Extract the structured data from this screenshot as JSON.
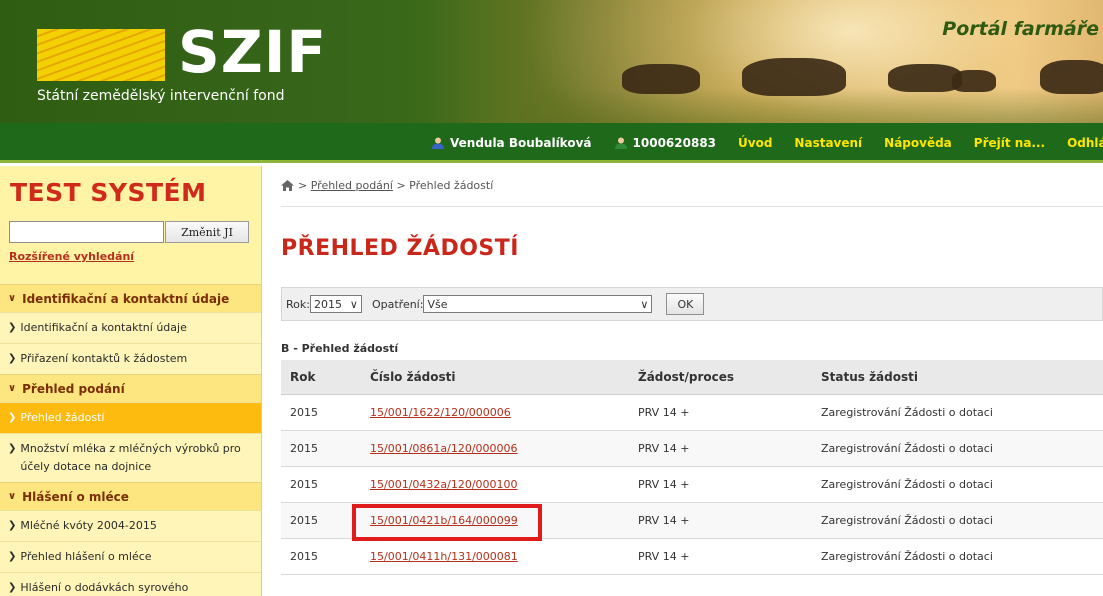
{
  "header": {
    "logo_text": "SZIF",
    "logo_subtitle": "Státní zemědělský intervenční fond",
    "portal_title": "Portál farmáře"
  },
  "nav": {
    "user_name": "Vendula Boubalíková",
    "client_id": "1000620883",
    "items": [
      "Úvod",
      "Nastavení",
      "Nápověda",
      "Přejít na...",
      "Odhlásit"
    ]
  },
  "sidebar": {
    "title": "TEST SYSTÉM",
    "search_value": "",
    "search_button": "Změnit JI",
    "advanced_search": "Rozšířené vyhledání",
    "sections": [
      {
        "label": "Identifikační a kontaktní údaje",
        "items": [
          "Identifikační a kontaktní údaje",
          "Přiřazení kontaktů k žádostem"
        ]
      },
      {
        "label": "Přehled podání",
        "items": [
          "Přehled žádostí",
          "Množství mléka z mléčných výrobků pro účely dotace na dojnice"
        ]
      },
      {
        "label": "Hlášení o mléce",
        "items": [
          "Mléčné kvóty 2004-2015",
          "Přehled hlášení o mléce",
          "Hlášení o dodávkách syrového"
        ]
      }
    ],
    "active_item": "Přehled žádostí"
  },
  "breadcrumb": {
    "separator": ">",
    "link": "Přehled podání",
    "current": "Přehled žádostí"
  },
  "main": {
    "title": "PŘEHLED ŽÁDOSTÍ",
    "filter": {
      "year_label": "Rok:",
      "year_value": "2015",
      "measure_label": "Opatření:",
      "measure_value": "Vše",
      "ok_label": "OK"
    },
    "section_label": "B - Přehled žádostí",
    "table": {
      "headers": [
        "Rok",
        "Číslo žádosti",
        "Žádost/proces",
        "Status žádosti"
      ],
      "rows": [
        [
          "2015",
          "15/001/1622/120/000006",
          "PRV 14 +",
          "Zaregistrování Žádosti o dotaci"
        ],
        [
          "2015",
          "15/001/0861a/120/000006",
          "PRV 14 +",
          "Zaregistrování Žádosti o dotaci"
        ],
        [
          "2015",
          "15/001/0432a/120/000100",
          "PRV 14 +",
          "Zaregistrování Žádosti o dotaci"
        ],
        [
          "2015",
          "15/001/0421b/164/000099",
          "PRV 14 +",
          "Zaregistrování Žádosti o dotaci"
        ],
        [
          "2015",
          "15/001/0411h/131/000081",
          "PRV 14 +",
          "Zaregistrování Žádosti o dotaci"
        ]
      ],
      "highlighted_row": 4
    }
  },
  "colors": {
    "header_green": "#2e5a12",
    "nav_green": "#1e6a1a",
    "nav_link": "#ffe600",
    "sidebar_bg": "#fff3a6",
    "sidebar_active": "#fdbb10",
    "title_red": "#c9271a",
    "link_red": "#b5301c",
    "highlight_red": "#e01b1b"
  },
  "icons": [
    "home-icon",
    "user-icon",
    "client-icon",
    "chevron-down-icon",
    "chevron-right-icon"
  ]
}
